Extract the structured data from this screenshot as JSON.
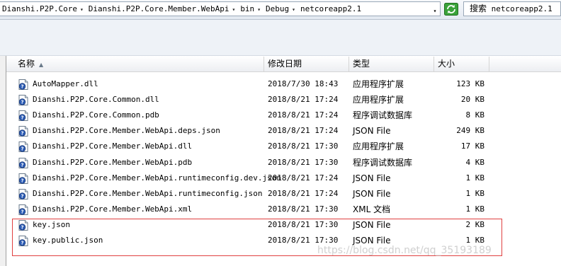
{
  "address_bar": {
    "crumbs": [
      "Dianshi.P2P.Core",
      "Dianshi.P2P.Core.Member.WebApi",
      "bin",
      "Debug",
      "netcoreapp2.1"
    ],
    "separator": "▾"
  },
  "search": {
    "label": "搜索",
    "value": "netcoreapp2.1"
  },
  "columns": {
    "name": "名称",
    "date": "修改日期",
    "type": "类型",
    "size": "大小"
  },
  "files": [
    {
      "name": "AutoMapper.dll",
      "date": "2018/7/30 18:43",
      "type": "应用程序扩展",
      "size": "123 KB",
      "icon": "dll-file-icon"
    },
    {
      "name": "Dianshi.P2P.Core.Common.dll",
      "date": "2018/8/21 17:24",
      "type": "应用程序扩展",
      "size": "20 KB",
      "icon": "dll-file-icon"
    },
    {
      "name": "Dianshi.P2P.Core.Common.pdb",
      "date": "2018/8/21 17:24",
      "type": "程序调试数据库",
      "size": "8 KB",
      "icon": "pdb-file-icon"
    },
    {
      "name": "Dianshi.P2P.Core.Member.WebApi.deps.json",
      "date": "2018/8/21 17:24",
      "type": "JSON File",
      "size": "249 KB",
      "icon": "json-file-icon"
    },
    {
      "name": "Dianshi.P2P.Core.Member.WebApi.dll",
      "date": "2018/8/21 17:30",
      "type": "应用程序扩展",
      "size": "17 KB",
      "icon": "dll-file-icon"
    },
    {
      "name": "Dianshi.P2P.Core.Member.WebApi.pdb",
      "date": "2018/8/21 17:30",
      "type": "程序调试数据库",
      "size": "4 KB",
      "icon": "pdb-file-icon"
    },
    {
      "name": "Dianshi.P2P.Core.Member.WebApi.runtimeconfig.dev.json",
      "date": "2018/8/21 17:24",
      "type": "JSON File",
      "size": "1 KB",
      "icon": "json-file-icon"
    },
    {
      "name": "Dianshi.P2P.Core.Member.WebApi.runtimeconfig.json",
      "date": "2018/8/21 17:24",
      "type": "JSON File",
      "size": "1 KB",
      "icon": "json-file-icon"
    },
    {
      "name": "Dianshi.P2P.Core.Member.WebApi.xml",
      "date": "2018/8/21 17:30",
      "type": "XML 文档",
      "size": "1 KB",
      "icon": "xml-file-icon"
    },
    {
      "name": "key.json",
      "date": "2018/8/21 17:30",
      "type": "JSON File",
      "size": "2 KB",
      "icon": "json-file-icon"
    },
    {
      "name": "key.public.json",
      "date": "2018/8/21 17:30",
      "type": "JSON File",
      "size": "1 KB",
      "icon": "json-file-icon"
    }
  ],
  "watermark": "https://blog.csdn.net/qq_35193189",
  "colors": {
    "highlight_border": "#e04040",
    "refresh_green": "#3aa23a"
  }
}
